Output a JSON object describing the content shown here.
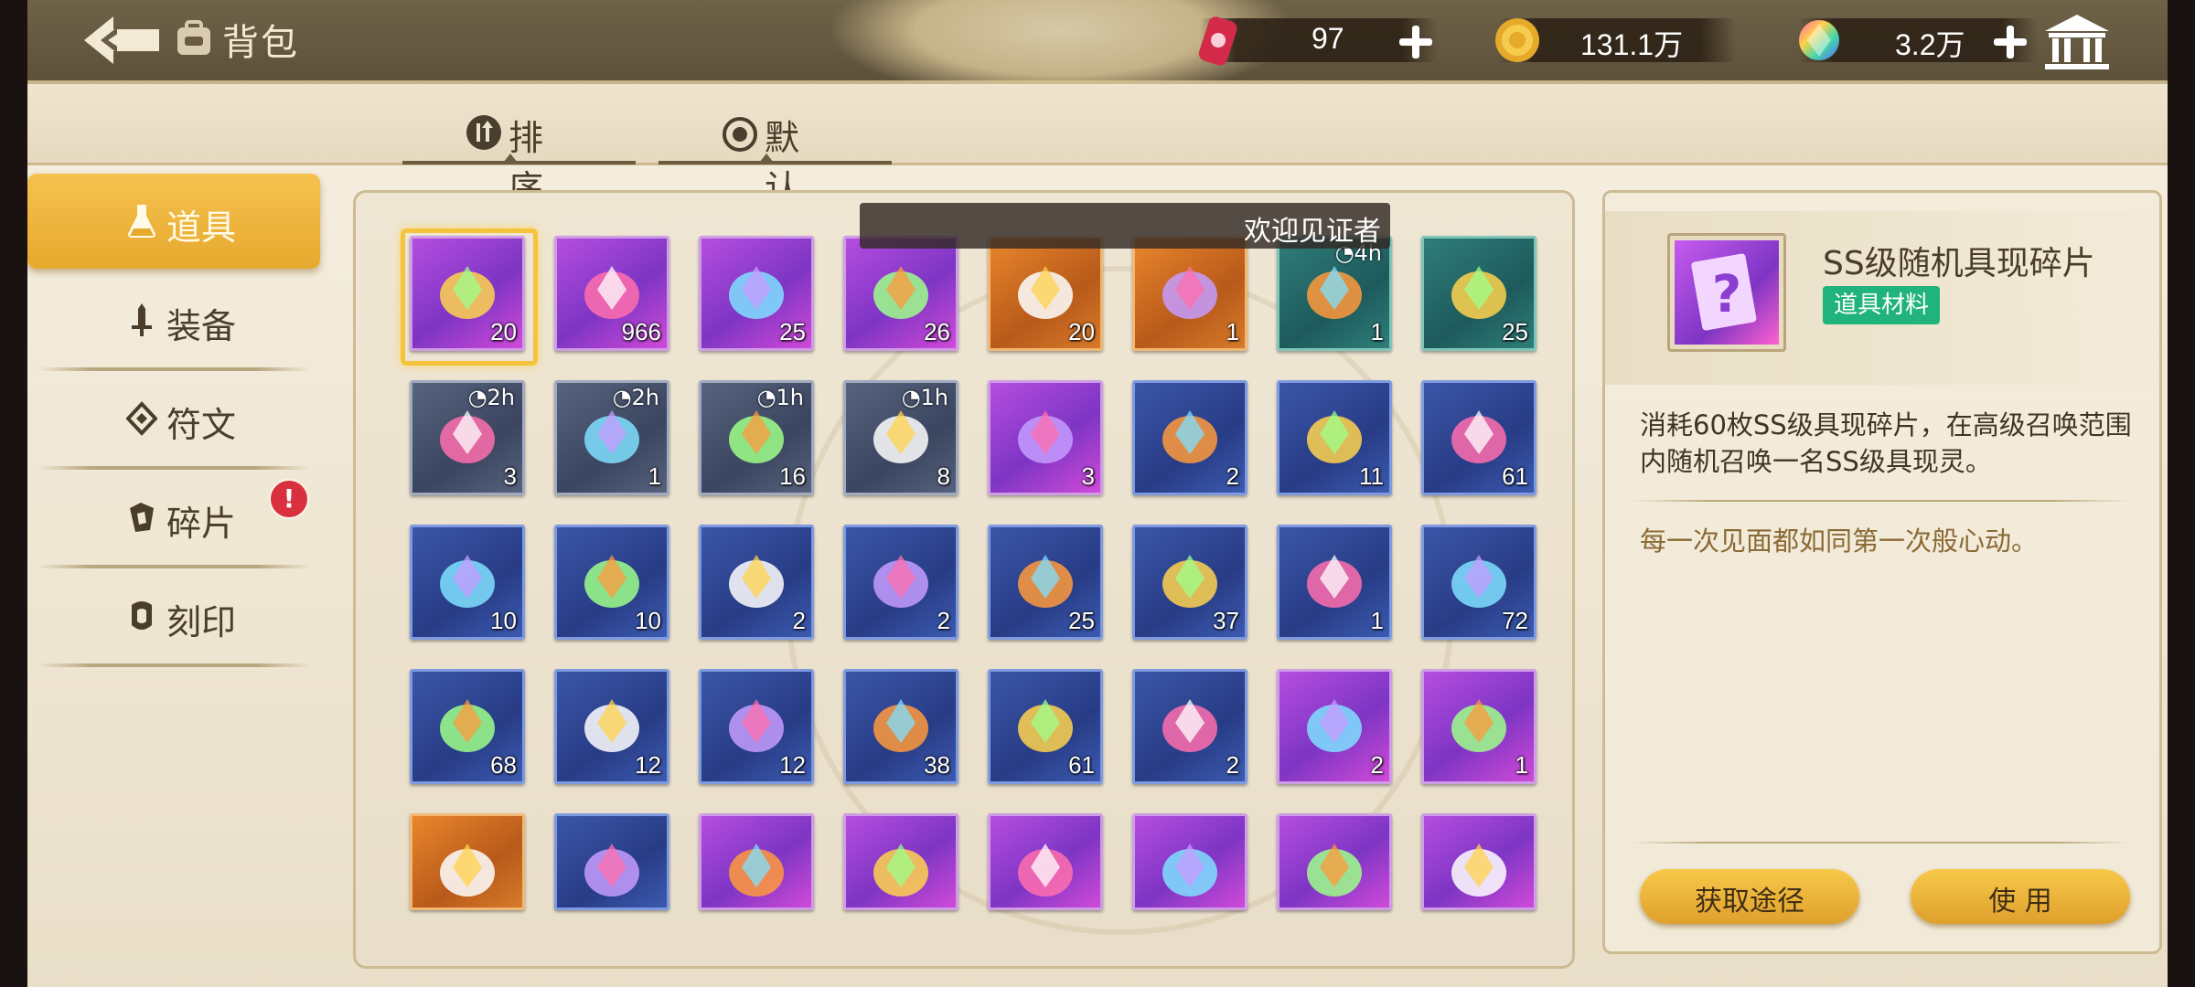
{
  "header": {
    "title": "背包",
    "currencies": [
      {
        "name": "stamina",
        "icon": "energy-can-icon",
        "value": "97",
        "addable": true
      },
      {
        "name": "gold",
        "icon": "gold-coin-icon",
        "value": "131.1万",
        "addable": false
      },
      {
        "name": "crystal",
        "icon": "rainbow-crystal-icon",
        "value": "3.2万",
        "addable": true
      }
    ]
  },
  "filters": {
    "sort_label": "排序",
    "default_label": "默认"
  },
  "tabs": [
    {
      "label": "道具",
      "icon": "potion-icon",
      "active": true
    },
    {
      "label": "装备",
      "icon": "sword-icon",
      "active": false
    },
    {
      "label": "符文",
      "icon": "rune-icon",
      "active": false
    },
    {
      "label": "碎片",
      "icon": "shard-icon",
      "active": false,
      "alert": "!"
    },
    {
      "label": "刻印",
      "icon": "seal-icon",
      "active": false
    }
  ],
  "toast": "欢迎见证者",
  "items": [
    {
      "icon": "ss-random-shard-icon",
      "rarity": "purple",
      "qty": "20",
      "selected": true
    },
    {
      "icon": "character-silhouette-card-icon",
      "rarity": "purple",
      "qty": "966"
    },
    {
      "icon": "red-potion-bottle-icon",
      "rarity": "purple",
      "qty": "25"
    },
    {
      "icon": "prism-crystal-icon",
      "rarity": "purple",
      "qty": "26"
    },
    {
      "icon": "orange-mystery-card-icon",
      "rarity": "orange",
      "qty": "20"
    },
    {
      "icon": "orange-character-card-icon",
      "rarity": "orange",
      "qty": "1"
    },
    {
      "icon": "hourglass-coins-icon",
      "rarity": "teal",
      "qty": "1",
      "timer": "4h"
    },
    {
      "icon": "crystal-bowl-icon",
      "rarity": "teal",
      "qty": "25"
    },
    {
      "icon": "hourglass-coins-icon",
      "rarity": "gray",
      "qty": "3",
      "timer": "2h"
    },
    {
      "icon": "hourglass-crystals-icon",
      "rarity": "gray",
      "qty": "1",
      "timer": "2h"
    },
    {
      "icon": "hourglass-coins-icon",
      "rarity": "gray",
      "qty": "16",
      "timer": "1h"
    },
    {
      "icon": "hourglass-crystals-icon",
      "rarity": "gray",
      "qty": "8",
      "timer": "1h"
    },
    {
      "icon": "robot-figure-icon",
      "rarity": "purple",
      "qty": "3"
    },
    {
      "icon": "green-crystal-icon",
      "rarity": "blue",
      "qty": "2"
    },
    {
      "icon": "leaf-branch-icon",
      "rarity": "blue",
      "qty": "11"
    },
    {
      "icon": "purple-ore-icon",
      "rarity": "blue",
      "qty": "61"
    },
    {
      "icon": "water-bowl-icon",
      "rarity": "blue",
      "qty": "10"
    },
    {
      "icon": "orange-teapot-icon",
      "rarity": "blue",
      "qty": "10"
    },
    {
      "icon": "pink-teapot-icon",
      "rarity": "blue",
      "qty": "2"
    },
    {
      "icon": "pink-jar-icon",
      "rarity": "blue",
      "qty": "2"
    },
    {
      "icon": "grain-pile-icon",
      "rarity": "blue",
      "qty": "25"
    },
    {
      "icon": "bread-buns-icon",
      "rarity": "blue",
      "qty": "37"
    },
    {
      "icon": "golden-apple-icon",
      "rarity": "blue",
      "qty": "1"
    },
    {
      "icon": "umbrella-icon",
      "rarity": "blue",
      "qty": "72"
    },
    {
      "icon": "lighter-icon",
      "rarity": "blue",
      "qty": "68"
    },
    {
      "icon": "open-book-icon",
      "rarity": "blue",
      "qty": "12"
    },
    {
      "icon": "closed-book-icon",
      "rarity": "blue",
      "qty": "12"
    },
    {
      "icon": "milk-carton-icon",
      "rarity": "blue",
      "qty": "38"
    },
    {
      "icon": "medal-icon",
      "rarity": "blue",
      "qty": "61"
    },
    {
      "icon": "pink-pillow-icon",
      "rarity": "blue",
      "qty": "2"
    },
    {
      "icon": "blue-gem-icon",
      "rarity": "purple",
      "qty": "2"
    },
    {
      "icon": "blue-coin-chip-icon",
      "rarity": "purple",
      "qty": "1"
    },
    {
      "icon": "purple-gem-icon",
      "rarity": "orange",
      "qty": ""
    },
    {
      "icon": "ice-crystal-icon",
      "rarity": "blue",
      "qty": ""
    },
    {
      "icon": "diamond-ring-icon",
      "rarity": "purple",
      "qty": ""
    },
    {
      "icon": "cat-robot-icon",
      "rarity": "purple",
      "qty": ""
    },
    {
      "icon": "jade-dagger-icon",
      "rarity": "purple",
      "qty": ""
    },
    {
      "icon": "red-star-crystal-icon",
      "rarity": "purple",
      "qty": ""
    },
    {
      "icon": "cyber-cube-icon",
      "rarity": "purple",
      "qty": ""
    },
    {
      "icon": "ice-cube-crystal-icon",
      "rarity": "purple",
      "qty": ""
    }
  ],
  "detail": {
    "name": "SS级随机具现碎片",
    "tag": "道具材料",
    "icon": "ss-random-shard-icon",
    "description": "消耗60枚SS级具现碎片，在高级召唤范围内随机召唤一名SS级具现灵。",
    "flavor": "每一次见面都如同第一次般心动。",
    "obtain_label": "获取途径",
    "use_label": "使 用"
  },
  "colors": {
    "accent_gold": "#e7a92e",
    "tag_green": "#20b37b",
    "alert_red": "#d8303c",
    "rarity_purple": "#b54de0",
    "rarity_orange": "#e9862c",
    "rarity_blue": "#3b56a8",
    "rarity_teal": "#2f7d7a",
    "rarity_gray": "#58647e"
  }
}
